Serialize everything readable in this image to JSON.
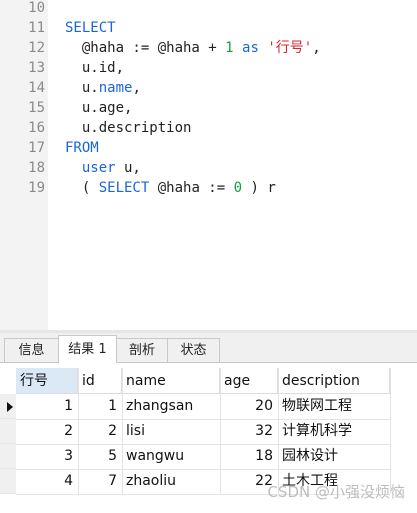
{
  "editor": {
    "lines": [
      {
        "n": "10",
        "tokens": []
      },
      {
        "n": "11",
        "tokens": [
          {
            "t": "SELECT",
            "c": "kw"
          }
        ]
      },
      {
        "n": "12",
        "tokens": [
          {
            "t": "  @haha := @haha + ",
            "c": "plain"
          },
          {
            "t": "1",
            "c": "num"
          },
          {
            "t": " ",
            "c": "plain"
          },
          {
            "t": "as",
            "c": "kw"
          },
          {
            "t": " ",
            "c": "plain"
          },
          {
            "t": "'行号'",
            "c": "str"
          },
          {
            "t": ",",
            "c": "plain"
          }
        ]
      },
      {
        "n": "13",
        "tokens": [
          {
            "t": "  u.id,",
            "c": "plain"
          }
        ]
      },
      {
        "n": "14",
        "tokens": [
          {
            "t": "  u.",
            "c": "plain"
          },
          {
            "t": "name",
            "c": "kw"
          },
          {
            "t": ",",
            "c": "plain"
          }
        ]
      },
      {
        "n": "15",
        "tokens": [
          {
            "t": "  u.age,",
            "c": "plain"
          }
        ]
      },
      {
        "n": "16",
        "tokens": [
          {
            "t": "  u.description",
            "c": "plain"
          }
        ]
      },
      {
        "n": "17",
        "tokens": [
          {
            "t": "FROM",
            "c": "kw"
          }
        ]
      },
      {
        "n": "18",
        "tokens": [
          {
            "t": "  ",
            "c": "plain"
          },
          {
            "t": "user",
            "c": "kw"
          },
          {
            "t": " u,",
            "c": "plain"
          }
        ]
      },
      {
        "n": "19",
        "tokens": [
          {
            "t": "  ( ",
            "c": "plain"
          },
          {
            "t": "SELECT",
            "c": "kw"
          },
          {
            "t": " @haha := ",
            "c": "plain"
          },
          {
            "t": "0",
            "c": "num"
          },
          {
            "t": " ) r",
            "c": "plain"
          }
        ]
      }
    ]
  },
  "tabs": [
    {
      "label": "信息",
      "active": false
    },
    {
      "label": "结果 1",
      "active": true
    },
    {
      "label": "剖析",
      "active": false
    },
    {
      "label": "状态",
      "active": false
    }
  ],
  "table": {
    "columns": [
      "行号",
      "id",
      "name",
      "age",
      "description"
    ],
    "rows": [
      [
        "1",
        "1",
        "zhangsan",
        "20",
        "物联网工程"
      ],
      [
        "2",
        "2",
        "lisi",
        "32",
        "计算机科学"
      ],
      [
        "3",
        "5",
        "wangwu",
        "18",
        "园林设计"
      ],
      [
        "4",
        "7",
        "zhaoliu",
        "22",
        "土木工程"
      ]
    ]
  },
  "watermark": "CSDN @小强没烦恼",
  "colors": {
    "keyword": "#1a66d8",
    "number": "#10a040",
    "string": "#d8262e",
    "header_selected": "#dbe9f7"
  }
}
